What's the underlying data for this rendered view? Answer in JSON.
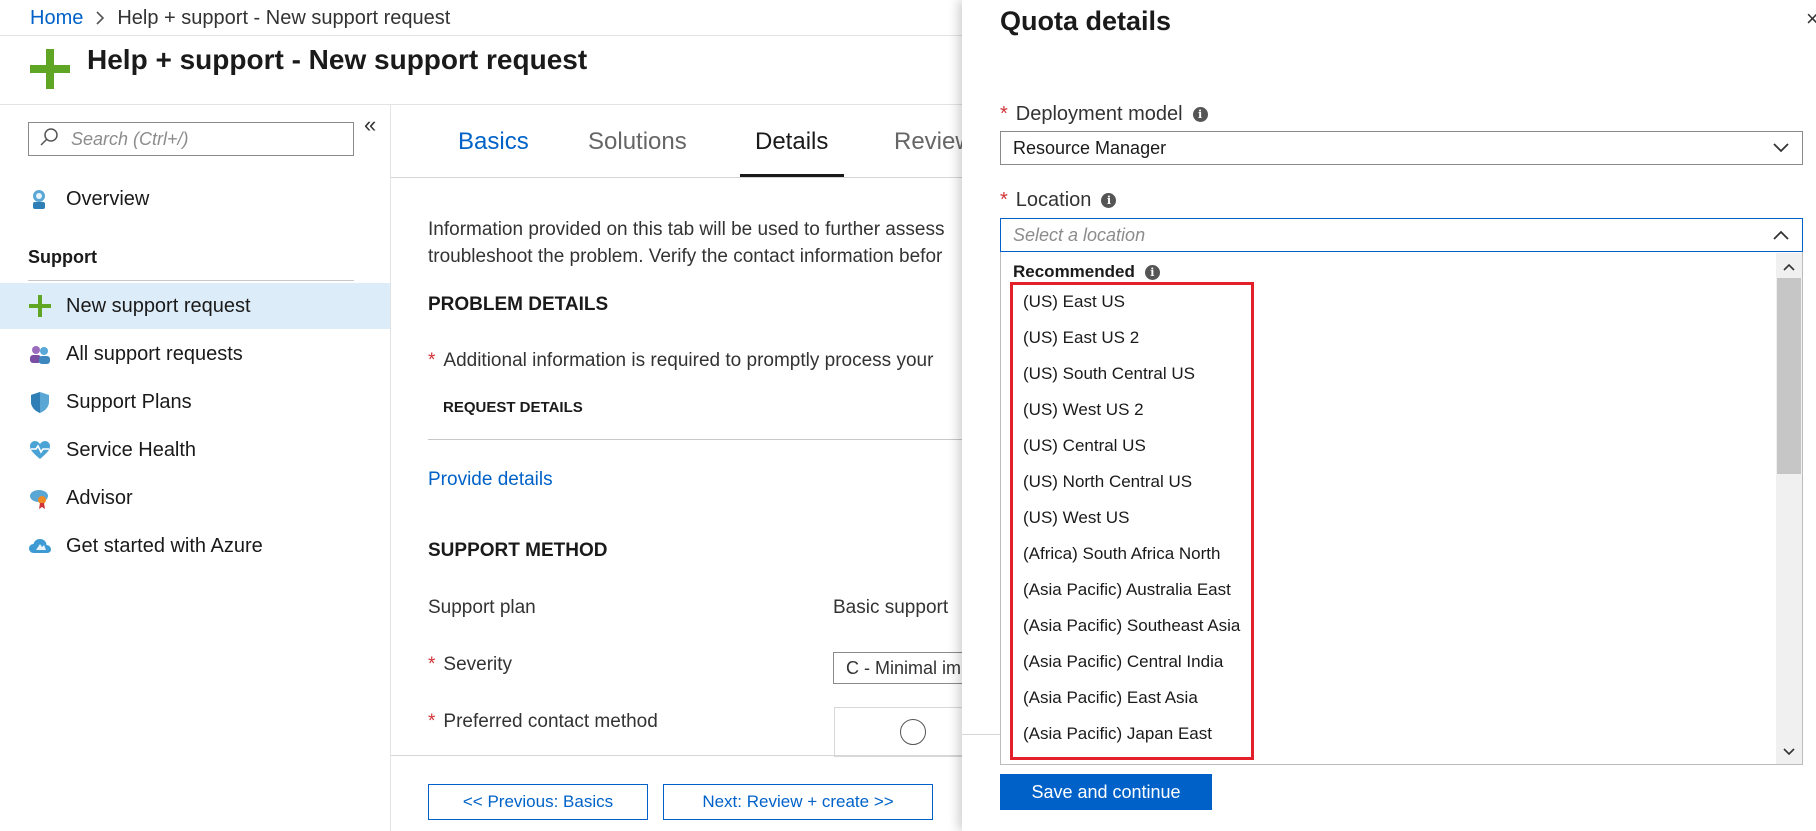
{
  "breadcrumb": {
    "home": "Home",
    "current": "Help + support - New support request"
  },
  "page": {
    "title": "Help + support - New support request"
  },
  "sidebar": {
    "search_placeholder": "Search (Ctrl+/)",
    "collapse": "«",
    "overview": "Overview",
    "section": "Support",
    "items": [
      {
        "label": "New support request",
        "icon": "plus-icon"
      },
      {
        "label": "All support requests",
        "icon": "people-icon"
      },
      {
        "label": "Support Plans",
        "icon": "shield-icon"
      },
      {
        "label": "Service Health",
        "icon": "heart-icon"
      },
      {
        "label": "Advisor",
        "icon": "advisor-icon"
      },
      {
        "label": "Get started with Azure",
        "icon": "cloud-icon"
      }
    ]
  },
  "tabs": [
    "Basics",
    "Solutions",
    "Details",
    "Review"
  ],
  "main": {
    "intro_line1": "Information provided on this tab will be used to further assess",
    "intro_line2": "troubleshoot the problem. Verify the contact information befor",
    "problem_details": "PROBLEM DETAILS",
    "additional_info": "Additional information is required to promptly process your",
    "request_details": "REQUEST DETAILS",
    "provide_details": "Provide details",
    "support_method": "SUPPORT METHOD",
    "support_plan_label": "Support plan",
    "support_plan_value": "Basic support",
    "severity_label": "Severity",
    "severity_value": "C - Minimal im",
    "contact_method_label": "Preferred contact method"
  },
  "footer": {
    "prev": "<< Previous: Basics",
    "next": "Next: Review + create >>"
  },
  "panel": {
    "title": "Quota details",
    "close": "×",
    "deployment_label": "Deployment model",
    "deployment_value": "Resource Manager",
    "location_label": "Location",
    "location_placeholder": "Select a location",
    "recommended": "Recommended",
    "locations": [
      "(US) East US",
      "(US) East US 2",
      "(US) South Central US",
      "(US) West US 2",
      "(US) Central US",
      "(US) North Central US",
      "(US) West US",
      "(Africa) South Africa North",
      "(Asia Pacific) Australia East",
      "(Asia Pacific) Southeast Asia",
      "(Asia Pacific) Central India",
      "(Asia Pacific) East Asia",
      "(Asia Pacific) Japan East"
    ],
    "save": "Save and continue"
  },
  "colors": {
    "accent": "#0062c8",
    "required": "#d13438",
    "highlight": "#e32029",
    "brand_green": "#5ea624"
  }
}
